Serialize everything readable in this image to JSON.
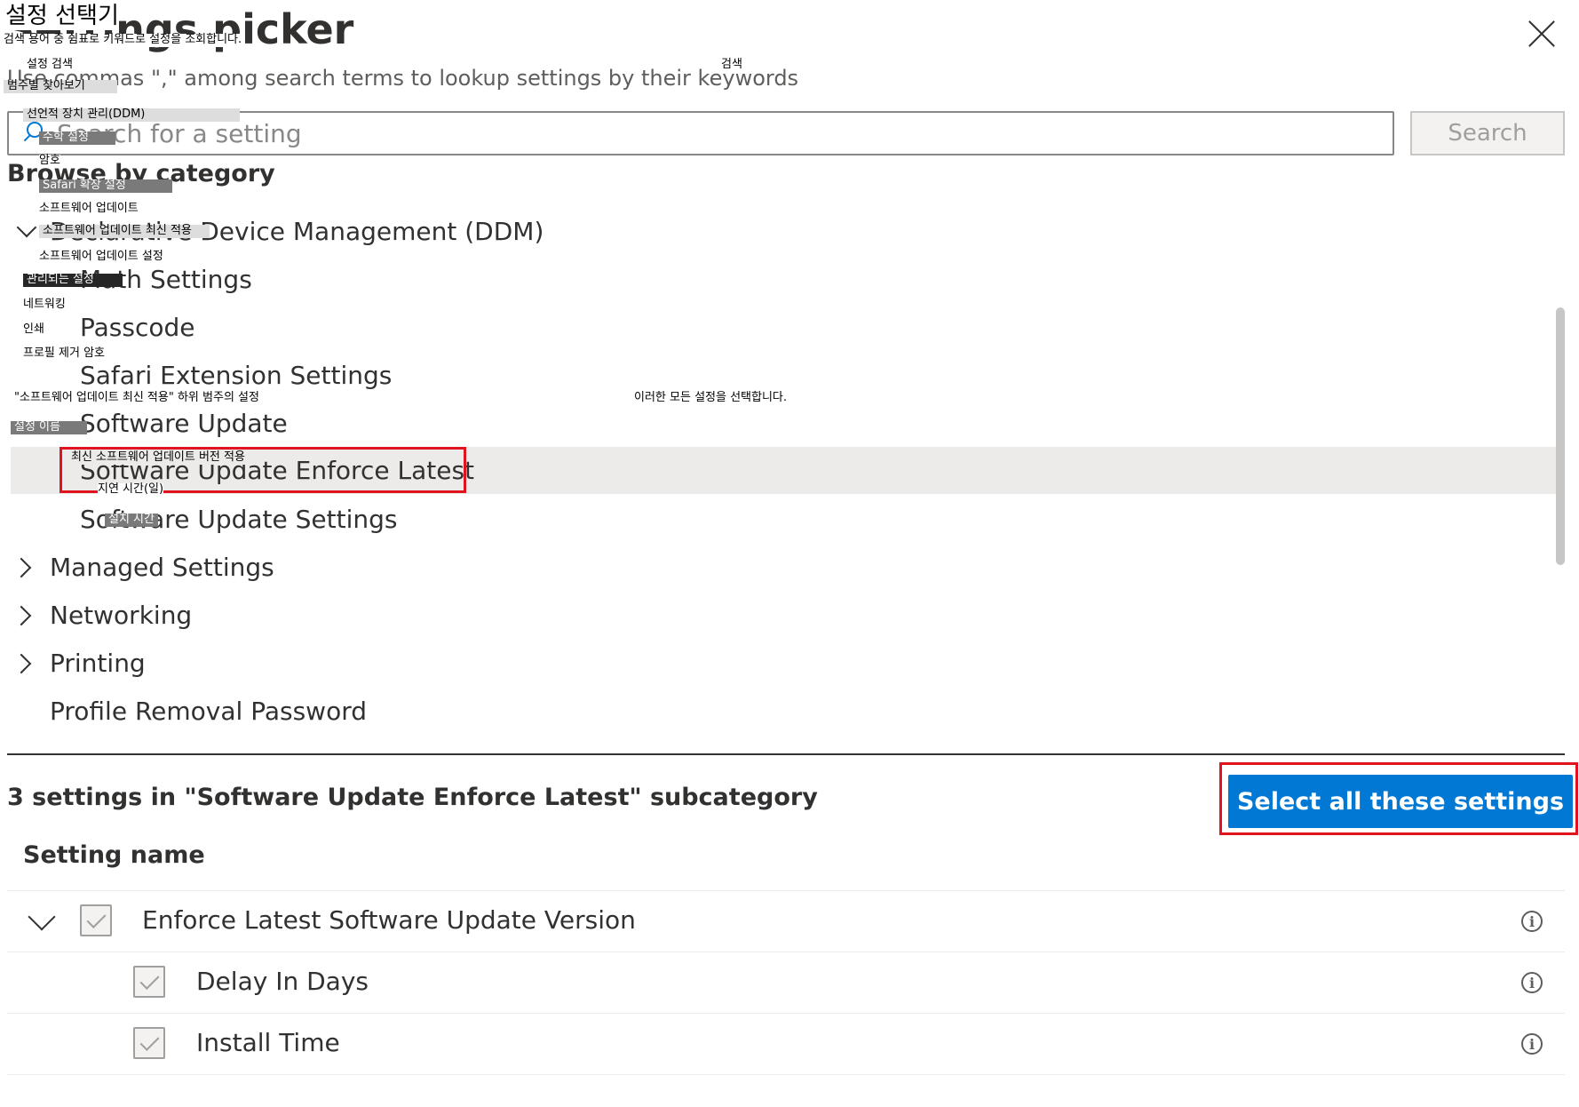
{
  "header": {
    "title": "Settings picker",
    "hint": "Use commas \",\" among search terms to lookup settings by their keywords",
    "close_icon": "close-icon"
  },
  "search": {
    "placeholder": "Search for a setting",
    "button_label": "Search",
    "icon": "search-icon"
  },
  "browse": {
    "label": "Browse by category",
    "categories": [
      {
        "label": "Declarative Device Management (DDM)",
        "state": "expanded"
      },
      {
        "label": "Math Settings"
      },
      {
        "label": "Passcode"
      },
      {
        "label": "Safari Extension Settings"
      },
      {
        "label": "Software Update"
      },
      {
        "label": "Software Update Enforce Latest",
        "selected": true
      },
      {
        "label": "Software Update Settings"
      },
      {
        "label": "Managed Settings",
        "state": "collapsed"
      },
      {
        "label": "Networking",
        "state": "collapsed"
      },
      {
        "label": "Printing",
        "state": "collapsed"
      },
      {
        "label": "Profile Removal Password"
      }
    ]
  },
  "results": {
    "count_text": "3 settings in \"Software Update Enforce Latest\" subcategory",
    "select_all_label": "Select all these settings",
    "column_header": "Setting name",
    "settings": [
      {
        "name": "Enforce Latest Software Update Version",
        "checked": true,
        "expanded": true
      },
      {
        "name": "Delay In Days",
        "checked": true
      },
      {
        "name": "Install Time",
        "checked": true
      }
    ]
  },
  "overlay_ko": {
    "title": "설정 선택기",
    "hint": "검색 용어 중 쉼표로 키워드로 설정을 조회합니다.",
    "search_placeholder": "설정 검색",
    "search_button": "검색",
    "browse": "범주별 찾아보기",
    "ddm": "선언적 장치 관리(DDM)",
    "math": "수학 설정",
    "passcode": "암호",
    "safari": "Safari 확장 설정",
    "software_update": "소프트웨어 업데이트",
    "enforce_latest": "소프트웨어 업데이트 최신 적용",
    "update_settings": "소프트웨어 업데이트 설정",
    "managed": "관리되는 설정",
    "networking": "네트워킹",
    "printing": "인쇄",
    "profile_removal": "프로필 제거 암호",
    "count_text": "\"소프트웨어 업데이트 최신 적용\" 하위 범주의 설정",
    "select_all": "이러한 모든 설정을 선택합니다.",
    "column_header": "설정 이름",
    "enforce_version": "최신 소프트웨어 업데이트 버전 적용",
    "delay": "지연 시간(일)",
    "install_time": "설치 시간"
  },
  "colors": {
    "accent": "#0078d4",
    "highlight": "#e0141e",
    "selected_row": "#edebe9"
  }
}
